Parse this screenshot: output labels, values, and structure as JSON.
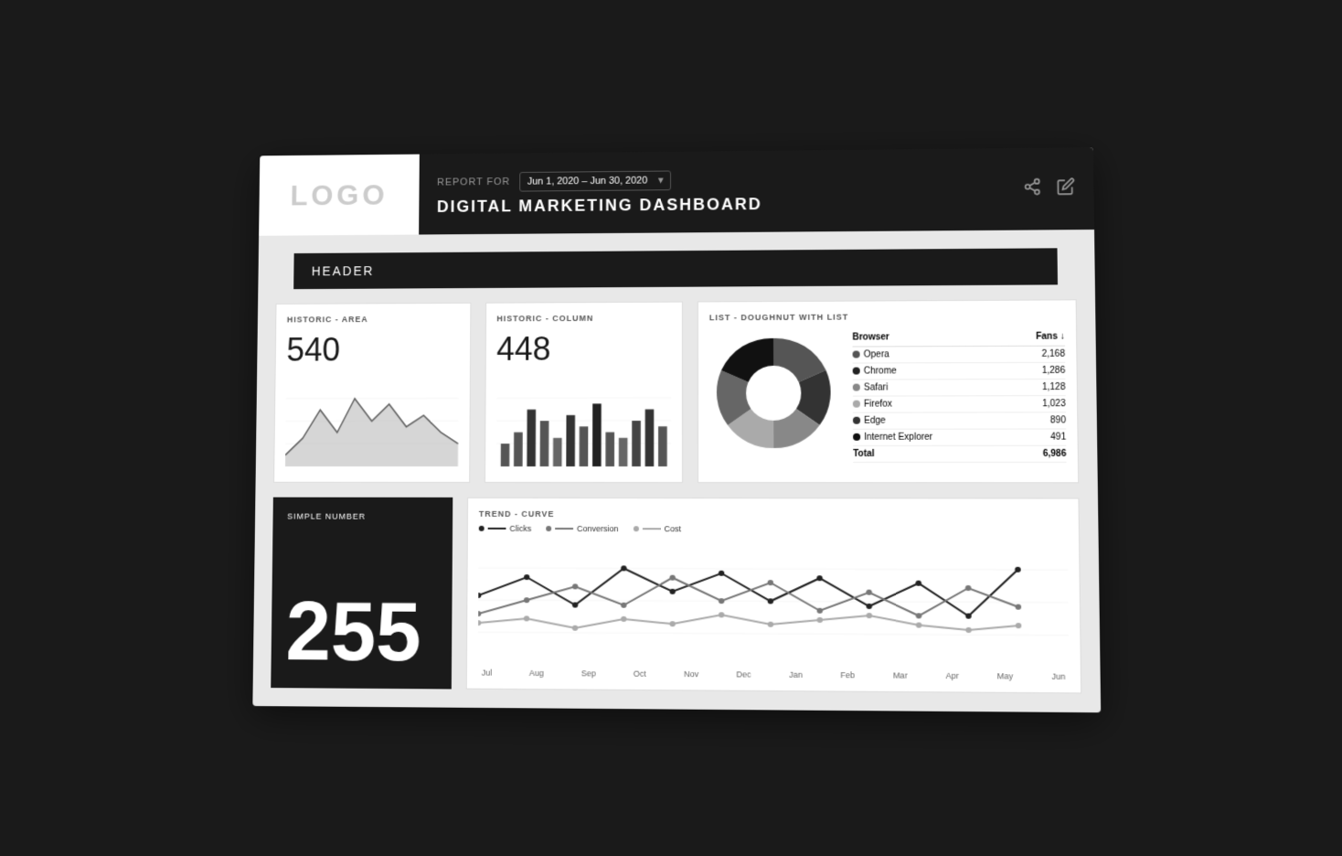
{
  "header": {
    "logo_text": "LOGO",
    "report_for_label": "REPORT FOR",
    "date_range": "Jun 1, 2020 – Jun 30, 2020",
    "dashboard_title": "DIGITAL MARKETING DASHBOARD",
    "share_icon": "share-icon",
    "edit_icon": "edit-icon"
  },
  "section": {
    "header_label": "HEADER"
  },
  "chart_area": {
    "title": "HISTORIC - AREA",
    "value": "540"
  },
  "chart_column": {
    "title": "HISTORIC - COLUMN",
    "value": "448"
  },
  "chart_doughnut": {
    "title": "LIST - DOUGHNUT WITH LIST",
    "col_browser": "Browser",
    "col_fans": "Fans",
    "rows": [
      {
        "name": "Opera",
        "color": "#555",
        "value": "2,168"
      },
      {
        "name": "Chrome",
        "color": "#222",
        "value": "1,286"
      },
      {
        "name": "Safari",
        "color": "#888",
        "value": "1,128"
      },
      {
        "name": "Firefox",
        "color": "#aaa",
        "value": "1,023"
      },
      {
        "name": "Edge",
        "color": "#333",
        "value": "890"
      },
      {
        "name": "Internet Explorer",
        "color": "#111",
        "value": "491"
      }
    ],
    "total_label": "Total",
    "total_value": "6,986"
  },
  "simple_number": {
    "title": "SIMPLE NUMBER",
    "value": "255"
  },
  "trend_curve": {
    "title": "TREND - CURVE",
    "legends": [
      {
        "label": "Clicks",
        "color": "#222"
      },
      {
        "label": "Conversion",
        "color": "#777"
      },
      {
        "label": "Cost",
        "color": "#aaa"
      }
    ],
    "x_labels": [
      "Jul",
      "Aug",
      "Sep",
      "Oct",
      "Nov",
      "Dec",
      "Jan",
      "Feb",
      "Mar",
      "Apr",
      "May",
      "Jun"
    ]
  }
}
